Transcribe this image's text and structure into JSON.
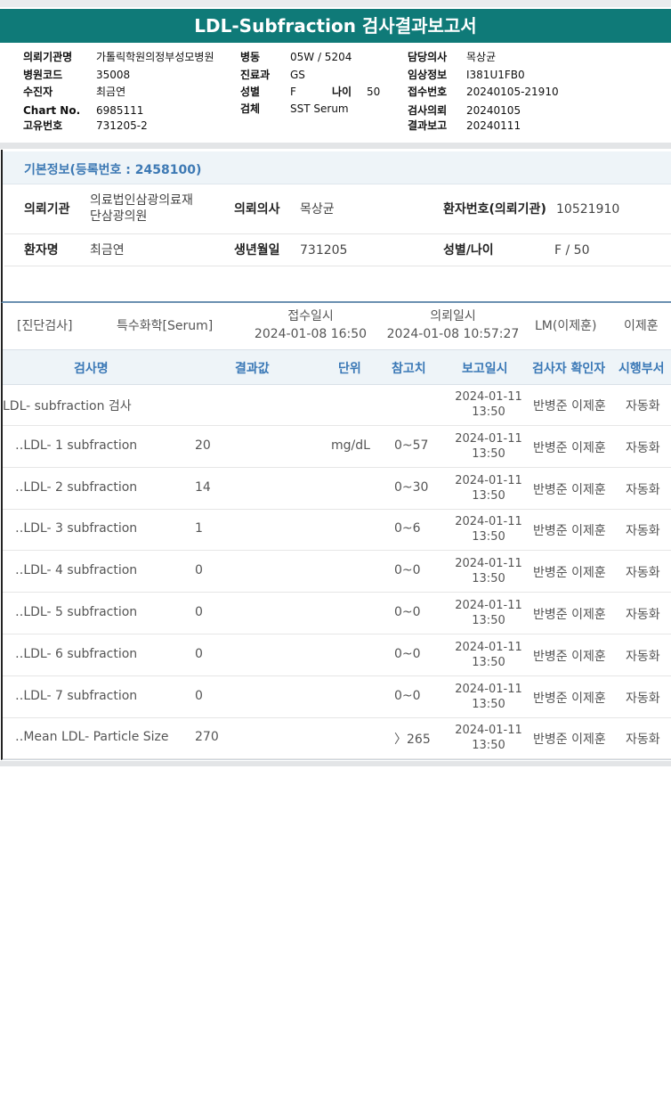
{
  "report": {
    "title": "LDL-Subfraction 검사결과보고서",
    "fields": [
      {
        "label": "의뢰기관명",
        "value": "가톨릭학원의정부성모병원"
      },
      {
        "label": "병원코드",
        "value": "35008"
      },
      {
        "label": "수진자",
        "value": "최금연"
      },
      {
        "label": "Chart No.",
        "value": "6985111"
      },
      {
        "label": "고유번호",
        "value": "731205-2"
      },
      {
        "label": "병동",
        "value": "05W / 5204"
      },
      {
        "label": "진료과",
        "value": "GS"
      },
      {
        "label": "성별",
        "value": "F"
      },
      {
        "label": "나이",
        "value": "50"
      },
      {
        "label": "검체",
        "value": "SST Serum"
      },
      {
        "label": "담당의사",
        "value": "목상균"
      },
      {
        "label": "임상정보",
        "value": "I381U1FB0"
      },
      {
        "label": "접수번호",
        "value": "20240105-21910"
      },
      {
        "label": "검사의뢰",
        "value": "20240105"
      },
      {
        "label": "결과보고",
        "value": "20240111"
      }
    ]
  },
  "basic": {
    "header": "기본정보(등록번호 : 2458100)",
    "items": [
      {
        "label": "의뢰기관",
        "value": "의료법인삼광의료재\n단삼광의원"
      },
      {
        "label": "의뢰의사",
        "value": "목상균"
      },
      {
        "label": "환자번호(의뢰기관)",
        "value": "10521910"
      },
      {
        "label": "환자명",
        "value": "최금연"
      },
      {
        "label": "생년월일",
        "value": "731205"
      },
      {
        "label": "성별/나이",
        "value": "F / 50"
      }
    ]
  },
  "order": {
    "category": "[진단검사]",
    "department": "특수화학[Serum]",
    "received_label": "접수일시",
    "received": "2024-01-08 16:50",
    "requested_label": "의뢰일시",
    "requested": "2024-01-08 10:57:27",
    "lm": "LM(이제훈)",
    "doctor": "이제훈"
  },
  "table": {
    "headers": {
      "name": "검사명",
      "result": "결과값",
      "unit": "단위",
      "ref": "참고치",
      "report_time": "보고일시",
      "checker": "검사자 확인자",
      "dept": "시행부서"
    },
    "rows": [
      {
        "name": "LDL- subfraction 검사",
        "result": "",
        "unit": "",
        "ref": "",
        "date": "2024-01-11",
        "time": "13:50",
        "checker": "반병준 이제훈",
        "dept": "자동화"
      },
      {
        "name": "‥LDL- 1 subfraction",
        "result": "20",
        "unit": "mg/dL",
        "ref": "0~57",
        "date": "2024-01-11",
        "time": "13:50",
        "checker": "반병준 이제훈",
        "dept": "자동화"
      },
      {
        "name": "‥LDL- 2 subfraction",
        "result": "14",
        "unit": "",
        "ref": "0~30",
        "date": "2024-01-11",
        "time": "13:50",
        "checker": "반병준 이제훈",
        "dept": "자동화"
      },
      {
        "name": "‥LDL- 3 subfraction",
        "result": "1",
        "unit": "",
        "ref": "0~6",
        "date": "2024-01-11",
        "time": "13:50",
        "checker": "반병준 이제훈",
        "dept": "자동화"
      },
      {
        "name": "‥LDL- 4 subfraction",
        "result": "0",
        "unit": "",
        "ref": "0~0",
        "date": "2024-01-11",
        "time": "13:50",
        "checker": "반병준 이제훈",
        "dept": "자동화"
      },
      {
        "name": "‥LDL- 5 subfraction",
        "result": "0",
        "unit": "",
        "ref": "0~0",
        "date": "2024-01-11",
        "time": "13:50",
        "checker": "반병준 이제훈",
        "dept": "자동화"
      },
      {
        "name": "‥LDL- 6 subfraction",
        "result": "0",
        "unit": "",
        "ref": "0~0",
        "date": "2024-01-11",
        "time": "13:50",
        "checker": "반병준 이제훈",
        "dept": "자동화"
      },
      {
        "name": "‥LDL- 7 subfraction",
        "result": "0",
        "unit": "",
        "ref": "0~0",
        "date": "2024-01-11",
        "time": "13:50",
        "checker": "반병준 이제훈",
        "dept": "자동화"
      },
      {
        "name": "‥Mean LDL- Particle Size",
        "result": "270",
        "unit": "",
        "ref": "〉265",
        "date": "2024-01-11",
        "time": "13:50",
        "checker": "반병준 이제훈",
        "dept": "자동화"
      }
    ]
  }
}
